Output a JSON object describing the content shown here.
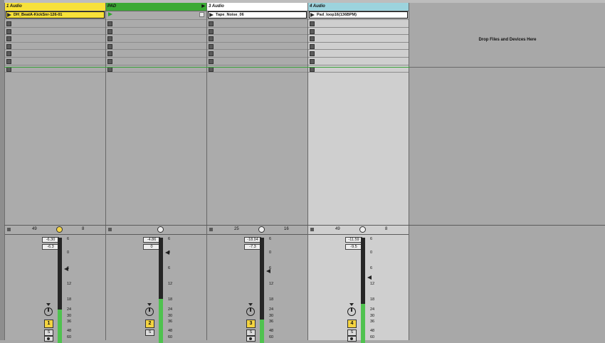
{
  "tracks": [
    {
      "title": "1 Audio",
      "color": "#f7e13a",
      "clip": "DH_BeatA-KickSnr-126-01",
      "clip_color": "#f7e13a",
      "input_left": "49",
      "input_right": "8",
      "vol_top": "-6.30",
      "vol_bottom": "-6.3",
      "number": "1",
      "solo": "S",
      "meter_level": 0.32,
      "fader_db": "6",
      "has_record": true
    },
    {
      "title": "PAD",
      "color": "#3caa35",
      "clip": "",
      "clip_color": "#3caa35",
      "input_left": "",
      "input_right": "",
      "vol_top": "-4.86",
      "vol_bottom": "0",
      "number": "2",
      "solo": "S",
      "meter_level": 0.42,
      "fader_db": "0",
      "has_record": false
    },
    {
      "title": "3 Audio",
      "color": "#ffffff",
      "clip": "Tape_Noise_06",
      "clip_color": "#ffffff",
      "input_left": "25",
      "input_right": "16",
      "vol_top": "-18.94",
      "vol_bottom": "-7.3",
      "number": "3",
      "solo": "S",
      "meter_level": 0.22,
      "fader_db": "6",
      "has_record": true
    },
    {
      "title": "4 Audio",
      "color": "#9cd3dd",
      "clip": "Pad_loop16(136BPM)",
      "clip_color": "#ffffff",
      "input_left": "49",
      "input_right": "8",
      "vol_top": "-11.59",
      "vol_bottom": "-9.5",
      "number": "4",
      "solo": "S",
      "meter_level": 0.37,
      "fader_db": "12",
      "has_record": true
    }
  ],
  "db_scale": [
    "6",
    "0",
    "6",
    "12",
    "18",
    "24",
    "30",
    "36",
    "48",
    "60"
  ],
  "drop_text": "Drop Files and Devices Here",
  "colors": {
    "selected_track_bg": "#cfcfcf",
    "meter_green": "#4fc24f",
    "accent_yellow": "#f4d440"
  }
}
